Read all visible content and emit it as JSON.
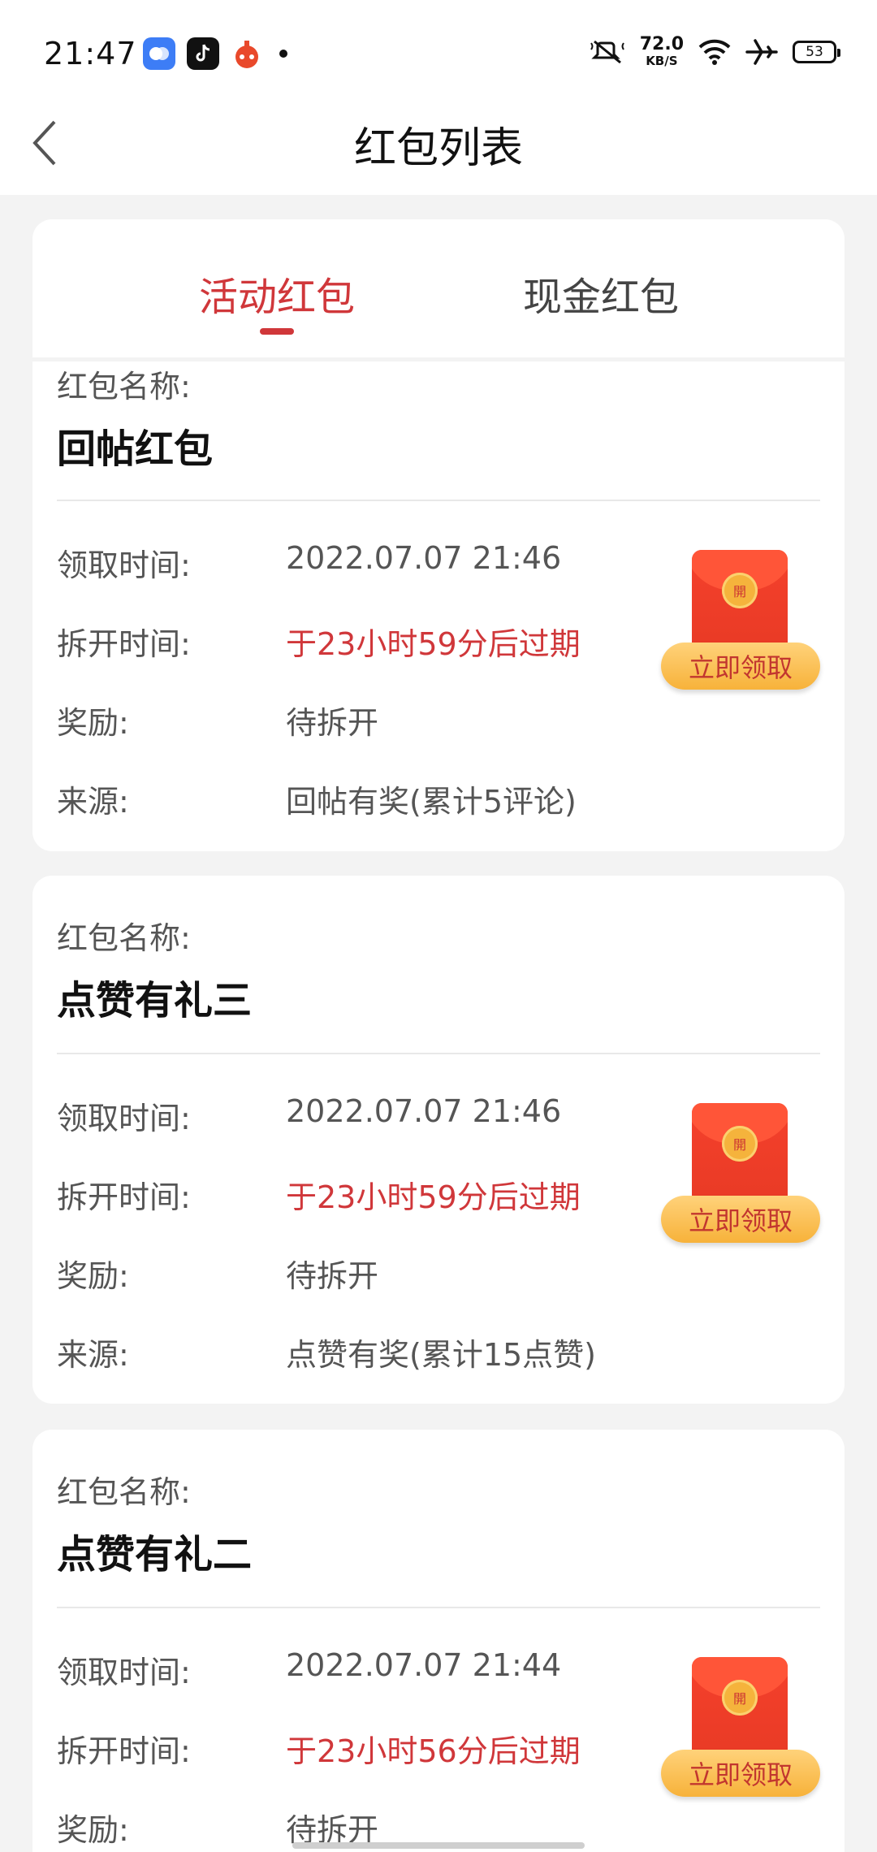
{
  "status_bar": {
    "time": "21:47",
    "speed_value": "72.0",
    "speed_unit": "KB/S",
    "battery": "53",
    "icons": [
      "mute-icon",
      "wifi-icon",
      "airplane-icon"
    ]
  },
  "header": {
    "title": "红包列表"
  },
  "tabs": [
    {
      "label": "活动红包",
      "active": true
    },
    {
      "label": "现金红包",
      "active": false
    }
  ],
  "labels": {
    "name": "红包名称:",
    "receive_time": "领取时间:",
    "open_time": "拆开时间:",
    "reward": "奖励:",
    "source": "来源:",
    "claim_button": "立即领取",
    "seal_char": "開"
  },
  "packets": [
    {
      "name": "回帖红包",
      "receive_time": "2022.07.07 21:46",
      "open_time": "于23小时59分后过期",
      "reward": "待拆开",
      "source": "回帖有奖(累计5评论)"
    },
    {
      "name": "点赞有礼三",
      "receive_time": "2022.07.07 21:46",
      "open_time": "于23小时59分后过期",
      "reward": "待拆开",
      "source": "点赞有奖(累计15点赞)"
    },
    {
      "name": "点赞有礼二",
      "receive_time": "2022.07.07 21:44",
      "open_time": "于23小时56分后过期",
      "reward": "待拆开"
    }
  ],
  "colors": {
    "accent_red": "#d0373a",
    "button_gold": "#f7b23a",
    "envelope_red": "#f5412c"
  }
}
